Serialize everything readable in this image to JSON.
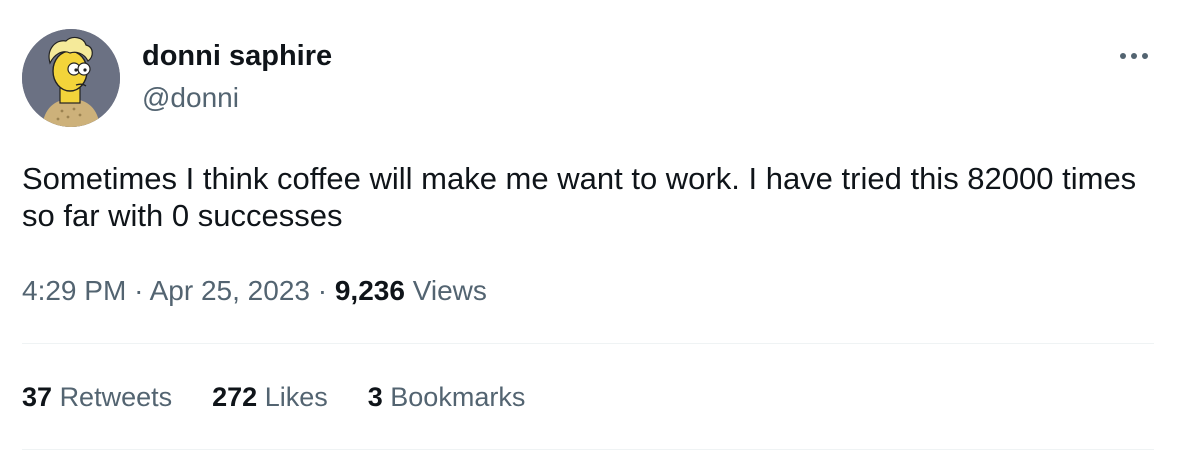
{
  "user": {
    "display_name": "donni saphire",
    "handle": "@donni",
    "avatar_icon": "cartoon-avatar-icon"
  },
  "tweet": {
    "text": "Sometimes I think coffee will make me want to work. I have tried this 82000 times so far with 0 successes"
  },
  "meta": {
    "time": "4:29 PM",
    "separator": "·",
    "date": "Apr 25, 2023",
    "views_count": "9,236",
    "views_label": "Views"
  },
  "stats": {
    "retweets_count": "37",
    "retweets_label": "Retweets",
    "likes_count": "272",
    "likes_label": "Likes",
    "bookmarks_count": "3",
    "bookmarks_label": "Bookmarks"
  },
  "colors": {
    "text_primary": "#0f1419",
    "text_secondary": "#536471",
    "divider": "#eff3f4"
  },
  "icons": {
    "more": "more-icon"
  }
}
